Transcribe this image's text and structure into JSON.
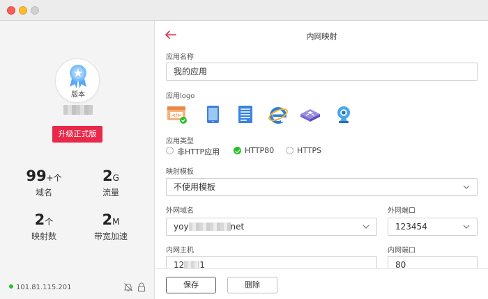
{
  "sidebar": {
    "badge_label": "版本",
    "upgrade_label": "升级正式版",
    "stats": [
      {
        "num": "99",
        "unit": "+个",
        "label": "域名"
      },
      {
        "num": "2",
        "unit": "G",
        "label": "流量"
      },
      {
        "num": "2",
        "unit": "个",
        "label": "映射数"
      },
      {
        "num": "2",
        "unit": "M",
        "label": "带宽加速"
      }
    ],
    "ip": "101.81.115.201"
  },
  "header": {
    "title": "内网映射"
  },
  "form": {
    "app_name_label": "应用名称",
    "app_name_value": "我的应用",
    "logo_label": "应用logo",
    "logos": [
      "code-window-icon",
      "tablet-icon",
      "document-icon",
      "ie-browser-icon",
      "router-icon",
      "webcam-icon"
    ],
    "type_label": "应用类型",
    "types": [
      "非HTTP应用",
      "HTTP80",
      "HTTPS"
    ],
    "selected_type": "HTTP80",
    "template_label": "映射模板",
    "template_value": "不使用模板",
    "ext_domain_label": "外网域名",
    "ext_domain_prefix": "yoy",
    "ext_domain_suffix": "net",
    "ext_port_label": "外网端口",
    "ext_port_value": "123454",
    "int_host_label": "内网主机",
    "int_host_prefix": "12",
    "int_host_suffix": "1",
    "int_port_label": "内网端口",
    "int_port_value": "80"
  },
  "footer": {
    "save_label": "保存",
    "delete_label": "删除"
  },
  "colors": {
    "accent": "#e8294a",
    "success": "#2bc02b"
  }
}
